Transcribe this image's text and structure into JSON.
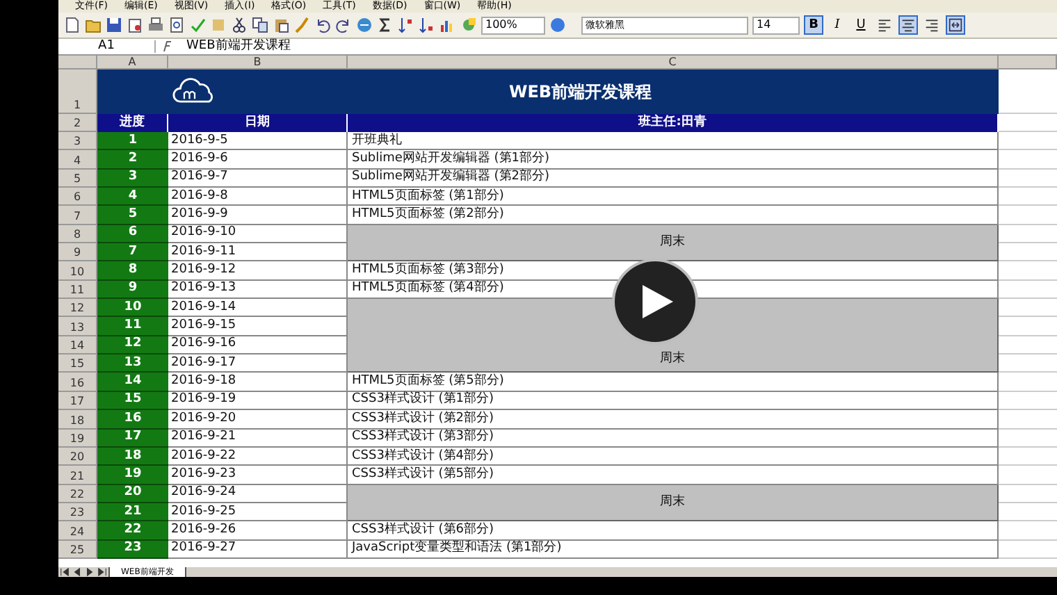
{
  "menu": [
    "文件(F)",
    "编辑(E)",
    "视图(V)",
    "插入(I)",
    "格式(O)",
    "工具(T)",
    "数据(D)",
    "窗口(W)",
    "帮助(H)"
  ],
  "toolbar": {
    "zoom": "100%",
    "font": "微软雅黑",
    "font_size": "14"
  },
  "format_buttons": [
    {
      "kind": "bold",
      "label": "B",
      "selected": true
    },
    {
      "kind": "italic",
      "label": "I",
      "selected": false
    },
    {
      "kind": "underline",
      "label": "U",
      "selected": false
    },
    {
      "kind": "align-left",
      "selected": false
    },
    {
      "kind": "align-center",
      "selected": true
    },
    {
      "kind": "align-right",
      "selected": false
    },
    {
      "kind": "merge",
      "selected": true
    }
  ],
  "formula_bar": {
    "cell": "A1",
    "content": "WEB前端开发课程"
  },
  "columns": [
    "A",
    "B",
    "C"
  ],
  "title_row": {
    "row": "1",
    "title": "WEB前端开发课程"
  },
  "header_row": {
    "row": "2",
    "cells": [
      "进度",
      "日期",
      "班主任:田青"
    ]
  },
  "rows": [
    {
      "kind": "lesson",
      "row": "3",
      "progress": "1",
      "date": "2016-9-5",
      "topic": "开班典礼"
    },
    {
      "kind": "lesson",
      "row": "4",
      "progress": "2",
      "date": "2016-9-6",
      "topic": "Sublime网站开发编辑器 (第1部分)"
    },
    {
      "kind": "lesson",
      "row": "5",
      "progress": "3",
      "date": "2016-9-7",
      "topic": "Sublime网站开发编辑器 (第2部分)"
    },
    {
      "kind": "lesson",
      "row": "6",
      "progress": "4",
      "date": "2016-9-8",
      "topic": "HTML5页面标签 (第1部分)"
    },
    {
      "kind": "lesson",
      "row": "7",
      "progress": "5",
      "date": "2016-9-9",
      "topic": "HTML5页面标签 (第2部分)"
    },
    {
      "kind": "weekend",
      "label": "周末",
      "days": [
        {
          "row": "8",
          "progress": "6",
          "date": "2016-9-10"
        },
        {
          "row": "9",
          "progress": "7",
          "date": "2016-9-11"
        }
      ]
    },
    {
      "kind": "lesson",
      "row": "10",
      "progress": "8",
      "date": "2016-9-12",
      "topic": "HTML5页面标签 (第3部分)"
    },
    {
      "kind": "lesson",
      "row": "11",
      "progress": "9",
      "date": "2016-9-13",
      "topic": "HTML5页面标签 (第4部分)"
    },
    {
      "kind": "weekend",
      "label": "周末",
      "days": [
        {
          "row": "12",
          "progress": "10",
          "date": "2016-9-14"
        },
        {
          "row": "13",
          "progress": "11",
          "date": "2016-9-15"
        },
        {
          "row": "14",
          "progress": "12",
          "date": "2016-9-16"
        },
        {
          "row": "15",
          "progress": "13",
          "date": "2016-9-17"
        }
      ]
    },
    {
      "kind": "lesson",
      "row": "16",
      "progress": "14",
      "date": "2016-9-18",
      "topic": "HTML5页面标签 (第5部分)"
    },
    {
      "kind": "lesson",
      "row": "17",
      "progress": "15",
      "date": "2016-9-19",
      "topic": "CSS3样式设计 (第1部分)"
    },
    {
      "kind": "lesson",
      "row": "18",
      "progress": "16",
      "date": "2016-9-20",
      "topic": "CSS3样式设计 (第2部分)"
    },
    {
      "kind": "lesson",
      "row": "19",
      "progress": "17",
      "date": "2016-9-21",
      "topic": "CSS3样式设计 (第3部分)"
    },
    {
      "kind": "lesson",
      "row": "20",
      "progress": "18",
      "date": "2016-9-22",
      "topic": "CSS3样式设计 (第4部分)"
    },
    {
      "kind": "lesson",
      "row": "21",
      "progress": "19",
      "date": "2016-9-23",
      "topic": "CSS3样式设计 (第5部分)"
    },
    {
      "kind": "weekend",
      "label": "周末",
      "days": [
        {
          "row": "22",
          "progress": "20",
          "date": "2016-9-24"
        },
        {
          "row": "23",
          "progress": "21",
          "date": "2016-9-25"
        }
      ]
    },
    {
      "kind": "lesson",
      "row": "24",
      "progress": "22",
      "date": "2016-9-26",
      "topic": "CSS3样式设计 (第6部分)"
    },
    {
      "kind": "lesson",
      "row": "25",
      "progress": "23",
      "date": "2016-9-27",
      "topic": "JavaScript变量类型和语法 (第1部分)"
    }
  ],
  "sheet_tabs": [
    {
      "label": "WEB前端开发",
      "selected": true
    }
  ]
}
